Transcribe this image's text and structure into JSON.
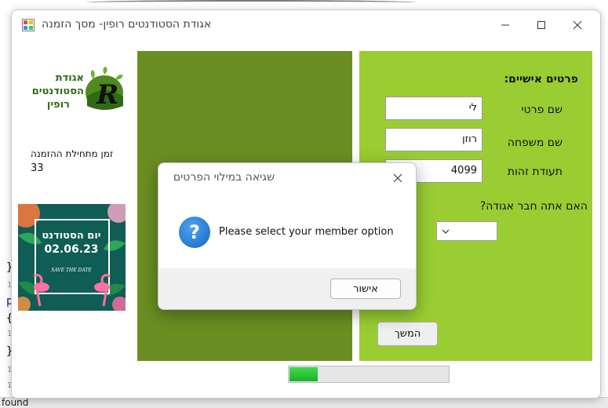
{
  "window": {
    "title": "אגודת הסטודנטים רופין- מסך הזמנה"
  },
  "logo": {
    "letter": "R",
    "text_line1": "אגודת",
    "text_line2": "הסטודנטים",
    "text_line3": "רופין"
  },
  "sidebar": {
    "time_label": "זמן מתחילת ההזמנה",
    "time_value": "33"
  },
  "poster": {
    "line1": "יום הסטודנט",
    "line2": "02.06.23",
    "line3": "SAVE THE DATE"
  },
  "form": {
    "section_title": "פרטים אישיים:",
    "first_name_label": "שם פרטי",
    "first_name_value": "לי",
    "last_name_label": "שם משפחה",
    "last_name_value": "רוזן",
    "id_label": "תעודת זהות",
    "id_value": "4099",
    "member_question": "האם אתה חבר אגודה?",
    "member_selected": "",
    "continue_label": "המשך"
  },
  "progress": {
    "value": 0.18
  },
  "dialog": {
    "title": "שגיאה במילוי הפרטים",
    "message": "Please select your member option",
    "ok_label": "אישור",
    "icon": "question-icon"
  },
  "background": {
    "found_text": "found",
    "line_number": "1"
  },
  "colors": {
    "panel_dark": "#6b8e23",
    "panel_light": "#9acd32",
    "progress_fill": "#2ecc40"
  }
}
